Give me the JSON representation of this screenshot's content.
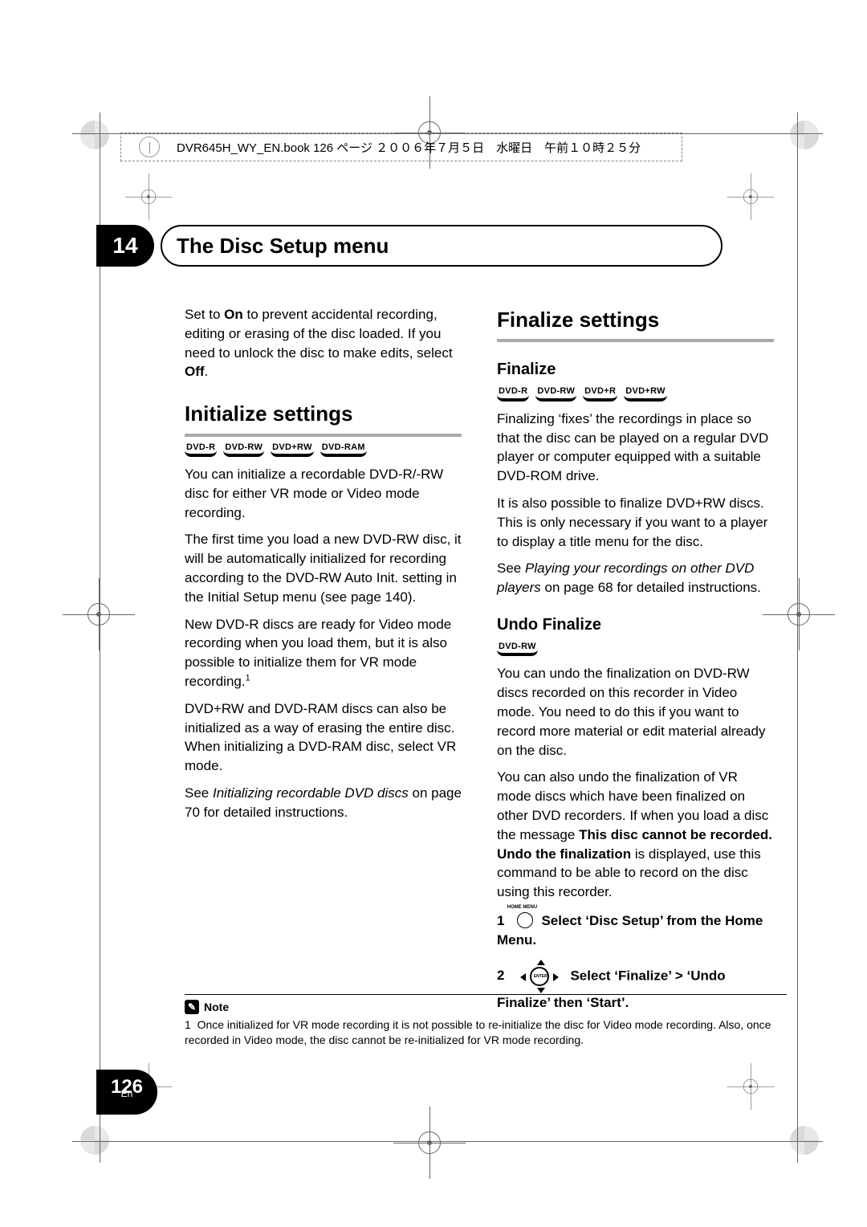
{
  "header_line": "DVR645H_WY_EN.book  126 ページ  ２００６年７月５日　水曜日　午前１０時２５分",
  "chapter_number": "14",
  "chapter_title": "The Disc Setup menu",
  "left": {
    "intro_pre": "Set to ",
    "intro_on": "On",
    "intro_mid": " to prevent accidental recording, editing or erasing of the disc loaded. If you need to unlock the disc to make edits, select ",
    "intro_off": "Off",
    "intro_end": ".",
    "heading": "Initialize settings",
    "badges": [
      "DVD-R",
      "DVD-RW",
      "DVD+RW",
      "DVD-RAM"
    ],
    "p1": "You can initialize a recordable DVD-R/-RW disc for either VR mode or Video mode recording.",
    "p2": "The first time you load a new DVD-RW disc, it will be automatically initialized for recording according to the DVD-RW Auto Init. setting in the Initial Setup menu (see page 140).",
    "p3_pre": "New DVD-R discs are ready for Video mode recording when you load them, but it is also possible to initialize them for VR mode recording.",
    "p3_fn": "1",
    "p4": "DVD+RW and DVD-RAM discs can also be initialized as a way of erasing the entire disc. When initializing a DVD-RAM disc, select VR mode.",
    "p5_pre": "See ",
    "p5_i": "Initializing recordable DVD discs",
    "p5_post": " on page 70 for detailed instructions."
  },
  "right": {
    "heading": "Finalize settings",
    "sub1": "Finalize",
    "badges1": [
      "DVD-R",
      "DVD-RW",
      "DVD+R",
      "DVD+RW"
    ],
    "p1": "Finalizing ‘fixes’ the recordings in place so that the disc can be played on a regular DVD player or computer equipped with a suitable DVD-ROM drive.",
    "p2": "It is also possible to finalize DVD+RW discs. This is only necessary if you want to a player to display a title menu for the disc.",
    "p3_pre": "See ",
    "p3_i": "Playing your recordings on other DVD players",
    "p3_post": " on page 68 for detailed instructions.",
    "sub2": "Undo Finalize",
    "badges2": [
      "DVD-RW"
    ],
    "p4": "You can undo the finalization on DVD-RW discs recorded on this recorder in Video mode. You need to do this if you want to record more material or edit material already on the disc.",
    "p5_pre": "You can also undo the finalization of VR mode discs which have been finalized on other DVD recorders. If when you load a disc the message ",
    "p5_b": "This disc cannot be recorded. Undo the finalization",
    "p5_post": " is displayed, use this command to be able to record on the disc using this recorder.",
    "step1_num": "1",
    "step1_text": "Select ‘Disc Setup’ from the Home Menu.",
    "step2_num": "2",
    "step2_text": "Select ‘Finalize’ > ‘Undo Finalize’ then ‘Start’."
  },
  "note": {
    "label": "Note",
    "fn": "1",
    "text": "Once initialized for VR mode recording it is not possible to re-initialize the disc for Video mode recording. Also, once recorded in Video mode, the disc cannot be re-initialized for VR mode recording."
  },
  "page_number": "126",
  "lang_label": "En"
}
